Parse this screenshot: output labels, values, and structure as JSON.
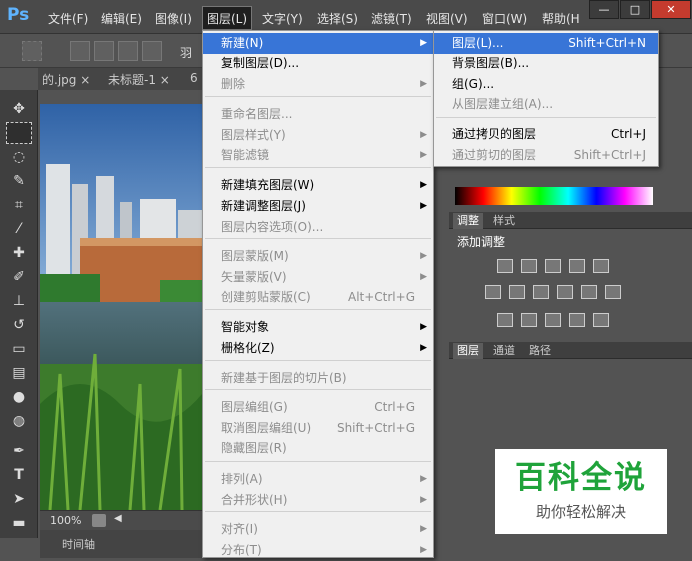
{
  "app": {
    "logo": "Ps"
  },
  "menubar": {
    "items": [
      "文件(F)",
      "编辑(E)",
      "图像(I)",
      "图层(L)",
      "文字(Y)",
      "选择(S)",
      "滤镜(T)",
      "视图(V)",
      "窗口(W)",
      "帮助(H"
    ]
  },
  "window_controls": {
    "minimize": "—",
    "restore": "□",
    "close": "✕"
  },
  "options": {
    "feather_label": "羽"
  },
  "tabs": [
    {
      "label": "的.jpg",
      "close": "×"
    },
    {
      "label": "未标题-1",
      "close": "×"
    },
    {
      "label": "6",
      "close": ""
    }
  ],
  "status": {
    "zoom": "100%",
    "timeline": "时间轴"
  },
  "layer_menu": {
    "items": [
      {
        "label": "新建(N)",
        "shortcut": "",
        "arrow": "▶",
        "disabled": false,
        "highlight": true
      },
      {
        "label": "复制图层(D)...",
        "shortcut": "",
        "arrow": "",
        "disabled": false
      },
      {
        "label": "删除",
        "shortcut": "",
        "arrow": "▶",
        "disabled": true
      },
      {
        "label": "重命名图层...",
        "shortcut": "",
        "arrow": "",
        "disabled": true
      },
      {
        "label": "图层样式(Y)",
        "shortcut": "",
        "arrow": "▶",
        "disabled": true
      },
      {
        "label": "智能滤镜",
        "shortcut": "",
        "arrow": "▶",
        "disabled": true
      },
      {
        "label": "新建填充图层(W)",
        "shortcut": "",
        "arrow": "▶",
        "disabled": false
      },
      {
        "label": "新建调整图层(J)",
        "shortcut": "",
        "arrow": "▶",
        "disabled": false
      },
      {
        "label": "图层内容选项(O)...",
        "shortcut": "",
        "arrow": "",
        "disabled": true
      },
      {
        "label": "图层蒙版(M)",
        "shortcut": "",
        "arrow": "▶",
        "disabled": true
      },
      {
        "label": "矢量蒙版(V)",
        "shortcut": "",
        "arrow": "▶",
        "disabled": true
      },
      {
        "label": "创建剪贴蒙版(C)",
        "shortcut": "Alt+Ctrl+G",
        "arrow": "",
        "disabled": true
      },
      {
        "label": "智能对象",
        "shortcut": "",
        "arrow": "▶",
        "disabled": false
      },
      {
        "label": "栅格化(Z)",
        "shortcut": "",
        "arrow": "▶",
        "disabled": false
      },
      {
        "label": "新建基于图层的切片(B)",
        "shortcut": "",
        "arrow": "",
        "disabled": true
      },
      {
        "label": "图层编组(G)",
        "shortcut": "Ctrl+G",
        "arrow": "",
        "disabled": true
      },
      {
        "label": "取消图层编组(U)",
        "shortcut": "Shift+Ctrl+G",
        "arrow": "",
        "disabled": true
      },
      {
        "label": "隐藏图层(R)",
        "shortcut": "",
        "arrow": "",
        "disabled": true
      },
      {
        "label": "排列(A)",
        "shortcut": "",
        "arrow": "▶",
        "disabled": true
      },
      {
        "label": "合并形状(H)",
        "shortcut": "",
        "arrow": "▶",
        "disabled": true
      },
      {
        "label": "对齐(I)",
        "shortcut": "",
        "arrow": "▶",
        "disabled": true
      },
      {
        "label": "分布(T)",
        "shortcut": "",
        "arrow": "▶",
        "disabled": true
      }
    ]
  },
  "new_submenu": {
    "items": [
      {
        "label": "图层(L)...",
        "shortcut": "Shift+Ctrl+N",
        "disabled": false,
        "highlight": true
      },
      {
        "label": "背景图层(B)...",
        "shortcut": "",
        "disabled": false
      },
      {
        "label": "组(G)...",
        "shortcut": "",
        "disabled": false
      },
      {
        "label": "从图层建立组(A)...",
        "shortcut": "",
        "disabled": true
      },
      {
        "label": "通过拷贝的图层",
        "shortcut": "Ctrl+J",
        "disabled": false
      },
      {
        "label": "通过剪切的图层",
        "shortcut": "Shift+Ctrl+J",
        "disabled": true
      }
    ]
  },
  "panels": {
    "adjust_tabs": [
      "调整",
      "样式"
    ],
    "add_adjust": "添加调整",
    "layer_tabs": [
      "图层",
      "通道",
      "路径"
    ]
  },
  "watermark": {
    "title": "百科全说",
    "subtitle": "助你轻松解决"
  },
  "colors": {
    "accent": "#3875d7",
    "watermark_green": "#1fa33a"
  }
}
